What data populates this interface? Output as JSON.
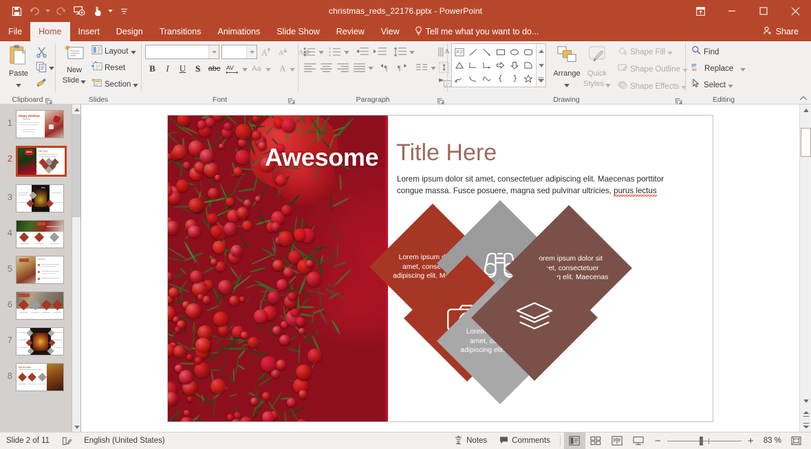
{
  "titlebar": {
    "document_title": "christmas_reds_22176.pptx - PowerPoint",
    "qat": [
      {
        "name": "save-icon",
        "tooltip": "Save"
      },
      {
        "name": "undo-icon",
        "tooltip": "Undo"
      },
      {
        "name": "redo-icon",
        "tooltip": "Redo"
      },
      {
        "name": "start-from-beginning-icon",
        "tooltip": "Start From Beginning"
      },
      {
        "name": "touch-mouse-mode-icon",
        "tooltip": "Touch/Mouse Mode"
      },
      {
        "name": "customize-quick-access-toolbar-icon",
        "tooltip": "Customize Quick Access Toolbar"
      }
    ],
    "window_controls": [
      {
        "name": "ribbon-display-options-icon",
        "tooltip": "Ribbon Display Options"
      },
      {
        "name": "minimize-icon",
        "tooltip": "Minimize"
      },
      {
        "name": "restore-icon",
        "tooltip": "Restore Down"
      },
      {
        "name": "close-icon",
        "tooltip": "Close"
      }
    ]
  },
  "tabs": [
    {
      "label": "File",
      "active": false
    },
    {
      "label": "Home",
      "active": true
    },
    {
      "label": "Insert",
      "active": false
    },
    {
      "label": "Design",
      "active": false
    },
    {
      "label": "Transitions",
      "active": false
    },
    {
      "label": "Animations",
      "active": false
    },
    {
      "label": "Slide Show",
      "active": false
    },
    {
      "label": "Review",
      "active": false
    },
    {
      "label": "View",
      "active": false
    }
  ],
  "tell_me": "Tell me what you want to do...",
  "share": "Share",
  "ribbon": {
    "groups": [
      {
        "label": "Clipboard"
      },
      {
        "label": "Slides"
      },
      {
        "label": "Font"
      },
      {
        "label": "Paragraph"
      },
      {
        "label": "Drawing"
      },
      {
        "label": "Editing"
      }
    ],
    "clipboard": {
      "paste": "Paste",
      "cut": "Cut",
      "copy": "Copy",
      "format_painter": "Format Painter"
    },
    "slides": {
      "new_slide": "New\nSlide",
      "new_slide_line1": "New",
      "new_slide_line2": "Slide",
      "layout": "Layout",
      "reset": "Reset",
      "section": "Section"
    },
    "font": {
      "font_name": "",
      "font_size": "",
      "increase_size": "A",
      "decrease_size": "A",
      "clear_formatting": "Clear All Formatting",
      "bold": "B",
      "italic": "I",
      "underline": "U",
      "shadow": "S",
      "strikethrough": "abc",
      "character_spacing": "AV",
      "change_case": "Aa",
      "font_color": "A"
    },
    "paragraph": {
      "bullets": "Bullets",
      "numbering": "Numbering",
      "decrease_indent": "Decrease List Level",
      "increase_indent": "Increase List Level",
      "line_spacing": "Line Spacing",
      "align_left": "Align Left",
      "center": "Center",
      "align_right": "Align Right",
      "justify": "Justify",
      "text_direction": "Text Direction",
      "align_text": "Align Text",
      "columns": "Add or Remove Columns",
      "convert_smartart": "Convert to SmartArt"
    },
    "drawing": {
      "arrange": "Arrange",
      "quick_styles_line1": "Quick",
      "quick_styles_line2": "Styles",
      "shape_fill": "Shape Fill",
      "shape_outline": "Shape Outline",
      "shape_effects": "Shape Effects"
    },
    "editing": {
      "find": "Find",
      "replace": "Replace",
      "select": "Select"
    }
  },
  "thumbnails": [
    {
      "number": "1",
      "selected": false
    },
    {
      "number": "2",
      "selected": true
    },
    {
      "number": "3",
      "selected": false
    },
    {
      "number": "4",
      "selected": false
    },
    {
      "number": "5",
      "selected": false
    },
    {
      "number": "6",
      "selected": false
    },
    {
      "number": "7",
      "selected": false
    },
    {
      "number": "8",
      "selected": false
    }
  ],
  "slide": {
    "overlay_title": "Awesome",
    "title": "Title Here",
    "body_text": "Lorem ipsum dolor sit amet, consectetuer adipiscing elit. Maecenas porttitor congue massa. Fusce posuere, magna sed pulvinar ultricies, ",
    "body_text_misspelled": "purus lectus",
    "diamonds": [
      {
        "id": "top-left-text",
        "kind": "text",
        "color": "#a63724",
        "text": "Lorem ipsum dolor sit amet, consectetuer adipiscing elit. Maecenas"
      },
      {
        "id": "top-center-icon",
        "kind": "icon",
        "color": "#9b9b9b",
        "icon": "binoculars-icon"
      },
      {
        "id": "top-right-text",
        "kind": "text",
        "color": "#7a5048",
        "text": "Lorem ipsum dolor sit amet, consectetuer adipiscing elit. Maecenas"
      },
      {
        "id": "bottom-left-icon",
        "kind": "icon",
        "color": "#a63724",
        "icon": "camera-icon"
      },
      {
        "id": "bottom-center-text",
        "kind": "text",
        "color": "#a8a8a8",
        "text": "Lorem ipsum dolor sit amet, consectetuer adipiscing elit. Maecenas"
      },
      {
        "id": "bottom-right-icon",
        "kind": "icon",
        "color": "#7a5048",
        "icon": "layers-icon"
      }
    ]
  },
  "statusbar": {
    "slide_position": "Slide 2 of 11",
    "language": "English (United States)",
    "notes": "Notes",
    "comments": "Comments",
    "zoom_level": "83 %",
    "views": [
      {
        "name": "normal-view",
        "active": true
      },
      {
        "name": "slide-sorter-view",
        "active": false
      },
      {
        "name": "reading-view",
        "active": false
      },
      {
        "name": "slide-show-view",
        "active": false
      }
    ],
    "zoom_out": "−",
    "zoom_in": "+",
    "fit_to_window": "Fit slide to current window"
  },
  "colors": {
    "accent": "#b7472a",
    "theme_red": "#a63724",
    "theme_brown": "#7a5048",
    "theme_gray": "#9b9b9b",
    "title_color": "#9d6b5d"
  }
}
